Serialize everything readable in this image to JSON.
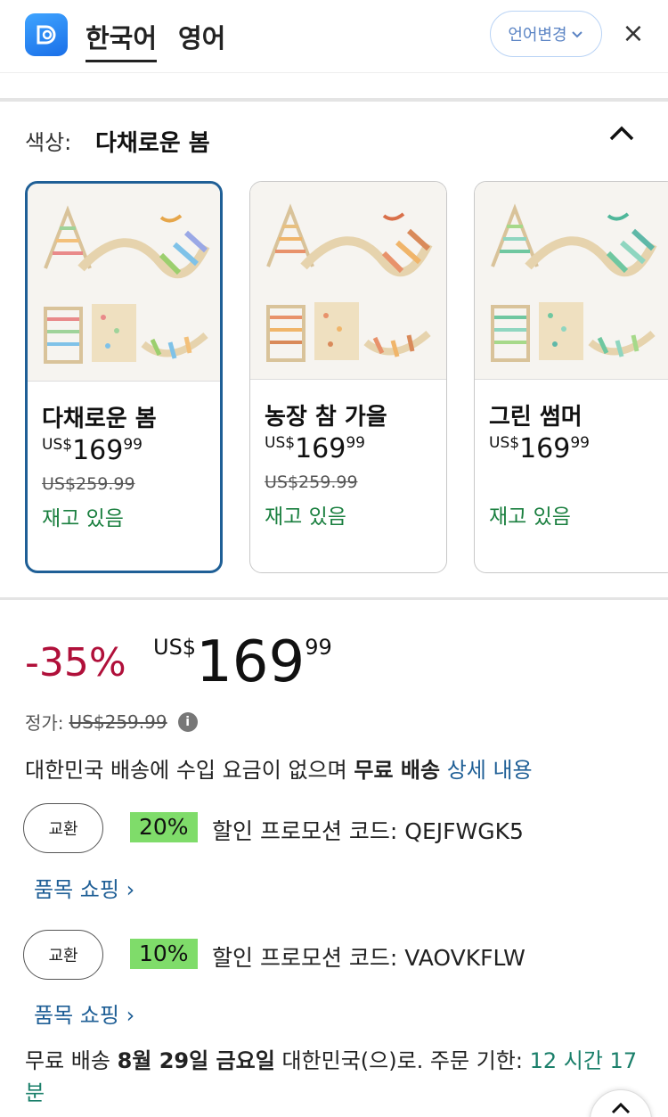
{
  "translate_bar": {
    "tabs": [
      {
        "label": "한국어",
        "active": true
      },
      {
        "label": "영어",
        "active": false
      }
    ],
    "change_language_label": "언어변경",
    "close_label": "×"
  },
  "color_section": {
    "label": "색상:",
    "selected_value": "다채로운 봄",
    "options": [
      {
        "name": "다채로운 봄",
        "currency": "US$",
        "price_whole": "169",
        "price_fraction": "99",
        "list_price": "US$259.99",
        "stock": "재고 있음",
        "selected": true
      },
      {
        "name": "농장 참 가을",
        "currency": "US$",
        "price_whole": "169",
        "price_fraction": "99",
        "list_price": "US$259.99",
        "stock": "재고 있음",
        "selected": false
      },
      {
        "name": "그린 썸머",
        "currency": "US$",
        "price_whole": "169",
        "price_fraction": "99",
        "list_price": "",
        "stock": "재고 있음",
        "selected": false
      }
    ]
  },
  "price": {
    "discount": "-35%",
    "currency": "US$",
    "whole": "169",
    "fraction": "99",
    "list_label": "정가:",
    "list_value": "US$259.99"
  },
  "shipping": {
    "text": "대한민국 배송에 수입 요금이 없으며",
    "free_label": "무료 배송",
    "details_link": "상세 내용"
  },
  "coupons": [
    {
      "button": "교환",
      "percent": "20%",
      "text": "할인 프로모션 코드: QEJFWGK5",
      "link": "품목 쇼핑 ›"
    },
    {
      "button": "교환",
      "percent": "10%",
      "text": "할인 프로모션 코드: VAOVKFLW",
      "link": "품목 쇼핑 ›"
    }
  ],
  "delivery": {
    "prefix": "무료 배송",
    "date": "8월 29일 금요일",
    "dest": "대한민국(으)로. 주문 기한:",
    "time": "12 시간 17 분"
  },
  "colors": {
    "accent_blue": "#1f5f96",
    "discount_red": "#b0103a",
    "stock_green": "#1a7f3f",
    "coupon_green": "#7fdc6a"
  }
}
